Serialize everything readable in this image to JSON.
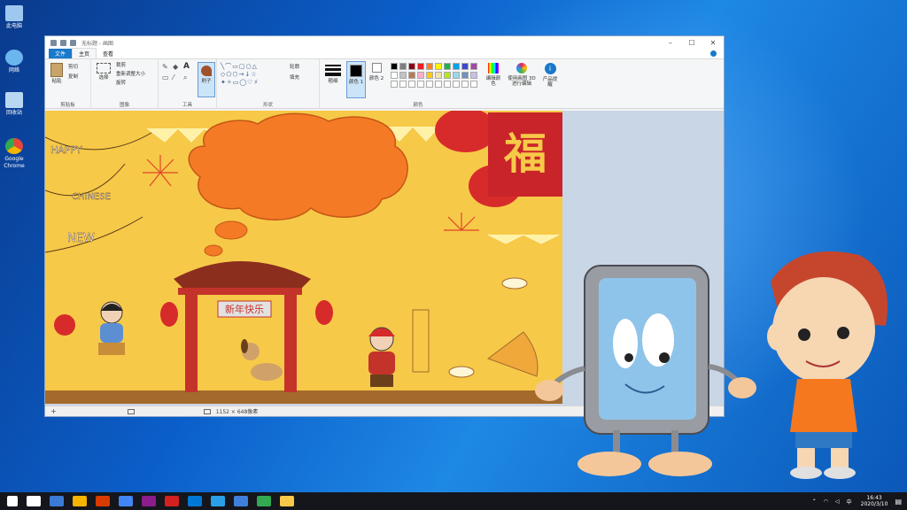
{
  "desktop": {
    "icons": [
      {
        "label": "此电脑",
        "color": "#9ec8f0"
      },
      {
        "label": "网络",
        "color": "#6bb6ef"
      },
      {
        "label": "回收站",
        "color": "#b8d8f2"
      },
      {
        "label": "Google Chrome",
        "color": "#e8453c"
      }
    ]
  },
  "window": {
    "title": "无标题 - 画图",
    "tabs": [
      "文件",
      "主页",
      "查看"
    ],
    "controls": [
      "–",
      "☐",
      "✕"
    ],
    "ribbon": {
      "clipboard": {
        "paste": "粘贴",
        "cut": "剪切",
        "copy": "复制",
        "label": "剪贴板"
      },
      "image": {
        "select": "选择",
        "crop": "裁剪",
        "resize": "重新调整大小",
        "rotate": "旋转",
        "label": "图像"
      },
      "tools": {
        "label": "工具",
        "brush": "刷子"
      },
      "shapes": {
        "outline": "轮廓",
        "fill": "填充",
        "label": "形状"
      },
      "size": "粗细",
      "color1": "颜色 1",
      "color2": "颜色 2",
      "edit_colors": "编辑颜色",
      "paint3d": "使用画图 3D 进行编辑",
      "product_alert": "产品提醒",
      "colors_label": "颜色"
    },
    "palette": [
      "#000000",
      "#7f7f7f",
      "#880015",
      "#ed1c24",
      "#ff7f27",
      "#fff200",
      "#22b14c",
      "#00a2e8",
      "#3f48cc",
      "#a349a4",
      "#ffffff",
      "#c3c3c3",
      "#b97a57",
      "#ffaec9",
      "#ffc90e",
      "#efe4b0",
      "#b5e61d",
      "#99d9ea",
      "#7092be",
      "#c8bfe7"
    ],
    "canvas_content": {
      "fu_char": "福",
      "banner": "新年快乐",
      "happy": "HAPPY",
      "chinese": "CHINESE",
      "new": "NEW"
    },
    "status": {
      "size": "1152 × 648像素"
    }
  },
  "taskbar": {
    "time": "16:43",
    "date": "2020/3/10",
    "ime": "中",
    "apps": [
      "#ffffff",
      "#3a7bd5",
      "#f4b400",
      "#d83b01",
      "#4285f4",
      "#8c1d8c",
      "#d42020",
      "#0078d7",
      "#2aa0e8",
      "#3f7fdc",
      "#33a852",
      "#f7c948"
    ]
  }
}
